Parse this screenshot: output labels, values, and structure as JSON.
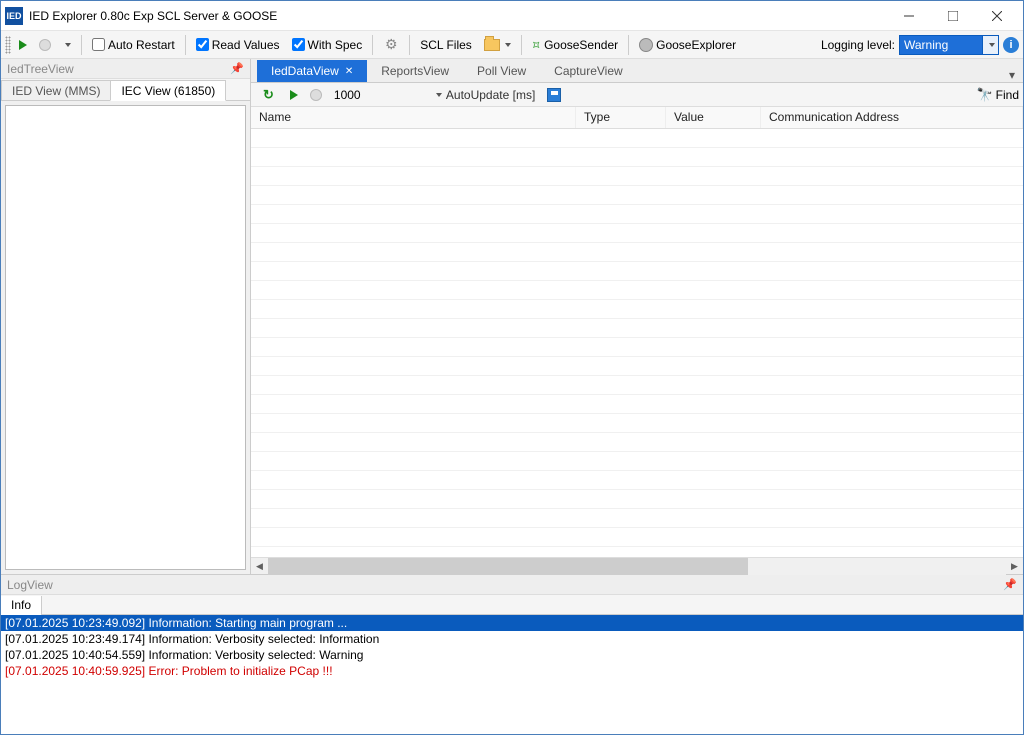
{
  "title": "IED Explorer 0.80c Exp SCL Server & GOOSE",
  "toolbar": {
    "auto_restart": "Auto Restart",
    "read_values": "Read Values",
    "with_spec": "With Spec",
    "scl_files": "SCL Files",
    "goose_sender": "GooseSender",
    "goose_explorer": "GooseExplorer",
    "logging_label": "Logging level:",
    "logging_value": "Warning"
  },
  "tree": {
    "title": "IedTreeView",
    "tabs": [
      "IED View (MMS)",
      "IEC View (61850)"
    ],
    "active": 1
  },
  "docs": {
    "tabs": [
      "IedDataView",
      "ReportsView",
      "Poll View",
      "CaptureView"
    ],
    "active": 0
  },
  "subbar": {
    "interval": "1000",
    "auto_update": "AutoUpdate [ms]",
    "find": "Find"
  },
  "grid": {
    "columns": [
      "Name",
      "Type",
      "Value",
      "Communication Address"
    ],
    "widths": [
      325,
      90,
      95,
      260
    ]
  },
  "log": {
    "title": "LogView",
    "tab": "Info",
    "lines": [
      {
        "text": "[07.01.2025 10:23:49.092] Information: Starting main program ...",
        "selected": true
      },
      {
        "text": "[07.01.2025 10:23:49.174] Information: Verbosity selected: Information"
      },
      {
        "text": "[07.01.2025 10:40:54.559] Information: Verbosity selected: Warning"
      },
      {
        "text": "[07.01.2025 10:40:59.925] Error: Problem to initialize PCap !!!",
        "error": true
      }
    ]
  }
}
